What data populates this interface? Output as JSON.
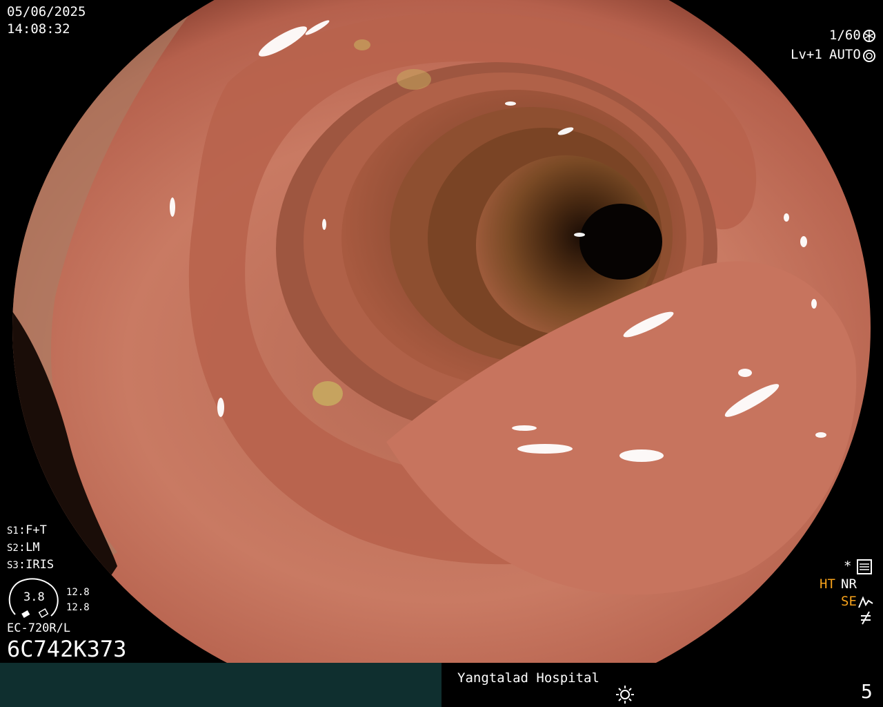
{
  "header": {
    "date": "05/06/2025",
    "time": "14:08:32"
  },
  "exposure": {
    "shutter": "1/60",
    "level": "Lv+1",
    "iris_mode": "AUTO"
  },
  "presets": {
    "s1": "F+T",
    "s2": "LM",
    "s3": "IRIS"
  },
  "gauge": {
    "value": "3.8",
    "top_value": "12.8",
    "bottom_value": "12.8"
  },
  "scope": {
    "model": "EC-720R/L",
    "serial": "6C742K373"
  },
  "status": {
    "star": "*",
    "ht": "HT",
    "nr": "NR",
    "se": "SE"
  },
  "footer": {
    "hospital": "Yangtalad Hospital",
    "page_number": "5"
  },
  "icons": [
    "shutter-icon",
    "aperture-icon",
    "settings-icon",
    "structure-enhance-icon",
    "freeze-off-icon",
    "brightness-icon"
  ],
  "colors": {
    "accent_orange": "#f7a21b",
    "footer_left_bg": "#0f2f2f",
    "mucosa": "#c7745e"
  }
}
